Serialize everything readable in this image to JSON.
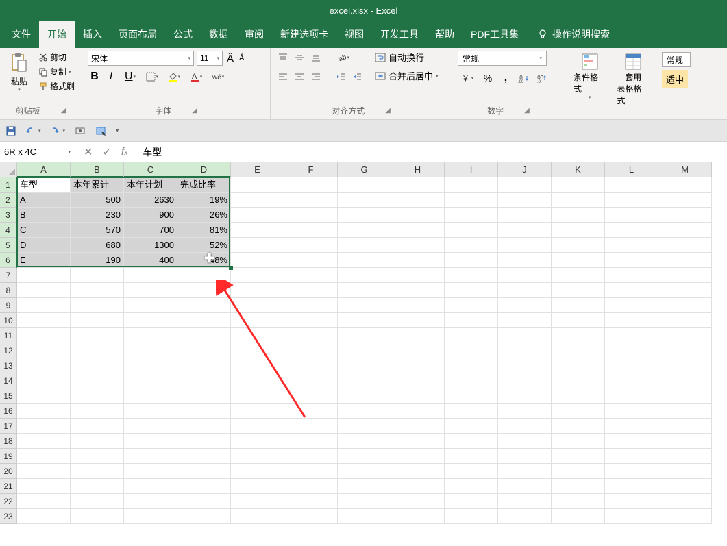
{
  "app": {
    "title": "excel.xlsx - Excel"
  },
  "tabs": {
    "file": "文件",
    "home": "开始",
    "insert": "插入",
    "page_layout": "页面布局",
    "formulas": "公式",
    "data": "数据",
    "review": "审阅",
    "new_tab": "新建选项卡",
    "view": "视图",
    "developer": "开发工具",
    "help": "帮助",
    "pdf_tools": "PDF工具集",
    "tell_me": "操作说明搜索"
  },
  "ribbon": {
    "clipboard": {
      "paste": "粘贴",
      "cut": "剪切",
      "copy": "复制",
      "format_painter": "格式刷",
      "group_label": "剪贴板"
    },
    "font": {
      "name": "宋体",
      "size": "11",
      "group_label": "字体"
    },
    "alignment": {
      "wrap_text": "自动换行",
      "merge_center": "合并后居中",
      "group_label": "对齐方式"
    },
    "number": {
      "format": "常规",
      "group_label": "数字"
    },
    "styles": {
      "conditional": "条件格式",
      "table": "套用",
      "table2": "表格格式",
      "group_label": ""
    },
    "right": {
      "combo": "常规",
      "fit": "适中"
    }
  },
  "namebox": {
    "ref": "6R x 4C"
  },
  "formula_bar": {
    "value": "车型"
  },
  "columns": [
    "A",
    "B",
    "C",
    "D",
    "E",
    "F",
    "G",
    "H",
    "I",
    "J",
    "K",
    "L",
    "M"
  ],
  "rows": [
    "1",
    "2",
    "3",
    "4",
    "5",
    "6",
    "7",
    "8",
    "9",
    "10",
    "11",
    "12",
    "13",
    "14",
    "15",
    "16",
    "17",
    "18",
    "19",
    "20",
    "21",
    "22",
    "23"
  ],
  "sheet": {
    "headers": {
      "A": "车型",
      "B": "本年累计",
      "C": "本年计划",
      "D": "完成比率"
    },
    "data": [
      {
        "A": "A",
        "B": "500",
        "C": "2630",
        "D": "19%"
      },
      {
        "A": "B",
        "B": "230",
        "C": "900",
        "D": "26%"
      },
      {
        "A": "C",
        "B": "570",
        "C": "700",
        "D": "81%"
      },
      {
        "A": "D",
        "B": "680",
        "C": "1300",
        "D": "52%"
      },
      {
        "A": "E",
        "B": "190",
        "C": "400",
        "D": "48%"
      }
    ]
  }
}
